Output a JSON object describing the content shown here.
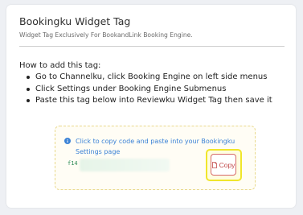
{
  "card": {
    "title": "Bookingku Widget Tag",
    "subtitle": "Widget Tag Exclusively For BookandLink Booking Engine."
  },
  "instructions": {
    "heading": "How to add this tag:",
    "steps": [
      "Go to Channelku, click Booking Engine on left side menus",
      "Click Settings under Booking Engine Submenus",
      "Paste this tag below into Reviewku Widget Tag then save it"
    ]
  },
  "code_box": {
    "hint": "Click to copy code and paste into your Bookingku Settings page",
    "code_snippet": "f14",
    "copy_label": "Copy",
    "copy_icon": "file-icon"
  },
  "colors": {
    "accent_blue": "#3b82d6",
    "copy_red": "#c24a4a",
    "highlight_yellow": "#f0e62b",
    "code_green": "#2e8b57"
  }
}
